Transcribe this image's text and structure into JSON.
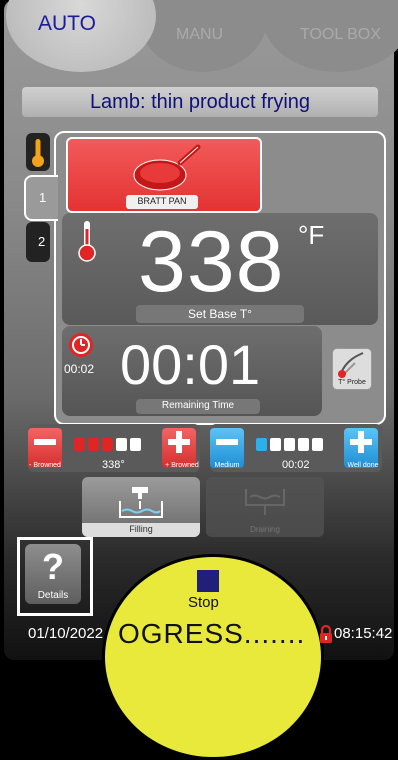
{
  "tabs": [
    {
      "label": "AUTO",
      "active": true
    },
    {
      "label": "MANU",
      "active": false
    },
    {
      "label": "TOOL BOX",
      "active": false
    }
  ],
  "recipe_title": "Lamb: thin product frying",
  "zone_tabs": [
    "1",
    "2"
  ],
  "bratt_pan_label": "BRATT PAN",
  "temperature": {
    "value": "338",
    "unit": "°F",
    "label": "Set Base T°"
  },
  "timer": {
    "value": "00:01",
    "small": "00:02",
    "label": "Remaining Time"
  },
  "probe_label": "T° Probe",
  "browning": {
    "minus_label": "- Browned",
    "plus_label": "+ Browned",
    "value": "338°",
    "level_filled": 3,
    "level_total": 5
  },
  "doneness": {
    "minus_label": "Medium",
    "plus_label": "Well done",
    "value": "00:02",
    "level_filled": 1,
    "level_total": 5
  },
  "filling_label": "Filling",
  "draining_label": "Draining",
  "details": {
    "icon_text": "?",
    "label": "Details"
  },
  "stop_label": "Stop",
  "progress_text": "OGRESS.......",
  "date": "01/10/2022",
  "time": "08:15:42",
  "colors": {
    "accent_blue": "#1c1c9a",
    "red": "#e43333",
    "blue": "#2a9ee0",
    "yellow": "#e9e93c"
  }
}
